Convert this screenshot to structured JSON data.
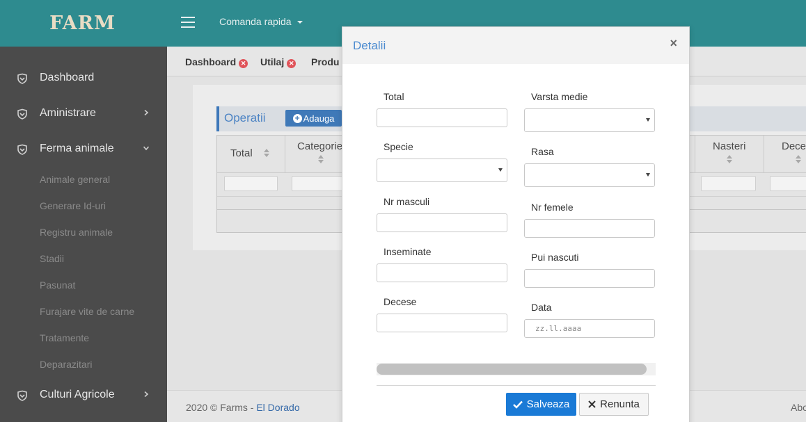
{
  "brand": {
    "logo_text": "FARM"
  },
  "topbar": {
    "quick_command": "Comanda rapida"
  },
  "sidebar": {
    "sections": [
      {
        "label": "Dashboard",
        "icon": "shield-icon",
        "has_chevron": false
      },
      {
        "label": "Aministrare",
        "icon": "shield-icon",
        "chevron": "chevron-right-icon"
      },
      {
        "label": "Ferma animale",
        "icon": "shield-icon",
        "chevron": "chevron-down-icon"
      },
      {
        "label": "Culturi Agricole",
        "icon": "shield-icon",
        "chevron": "chevron-right-icon"
      }
    ],
    "sub_items": [
      "Animale general",
      "Generare Id-uri",
      "Registru animale",
      "Stadii",
      "Pasunat",
      "Furajare vite de carne",
      "Tratamente",
      "Deparazitari"
    ]
  },
  "tabs": [
    {
      "label": "Dashboard"
    },
    {
      "label": "Utilaj"
    },
    {
      "label": "Produ"
    }
  ],
  "operations": {
    "title": "Operatii",
    "add_label": "Adauga",
    "columns": [
      "Total",
      "Categorie",
      "Nasteri",
      "Deces"
    ]
  },
  "footer": {
    "text": "2020 © Farms - ",
    "link": "El Dorado",
    "right": "About"
  },
  "modal": {
    "title": "Detalii",
    "close": "×",
    "fields": {
      "total": "Total",
      "varsta_medie": "Varsta medie",
      "specie": "Specie",
      "rasa": "Rasa",
      "nr_masculi": "Nr masculi",
      "nr_femele": "Nr femele",
      "inseminate": "Inseminate",
      "pui_nascuti": "Pui nascuti",
      "decese": "Decese",
      "data": "Data"
    },
    "date_placeholder": "zz.ll.aaaa",
    "save_label": "Salveaza",
    "cancel_label": "Renunta"
  },
  "colors": {
    "header": "#2e8b8f",
    "sidebar": "#4b4b4b",
    "accent": "#1a7ad6",
    "title_blue": "#4d8cd0"
  }
}
